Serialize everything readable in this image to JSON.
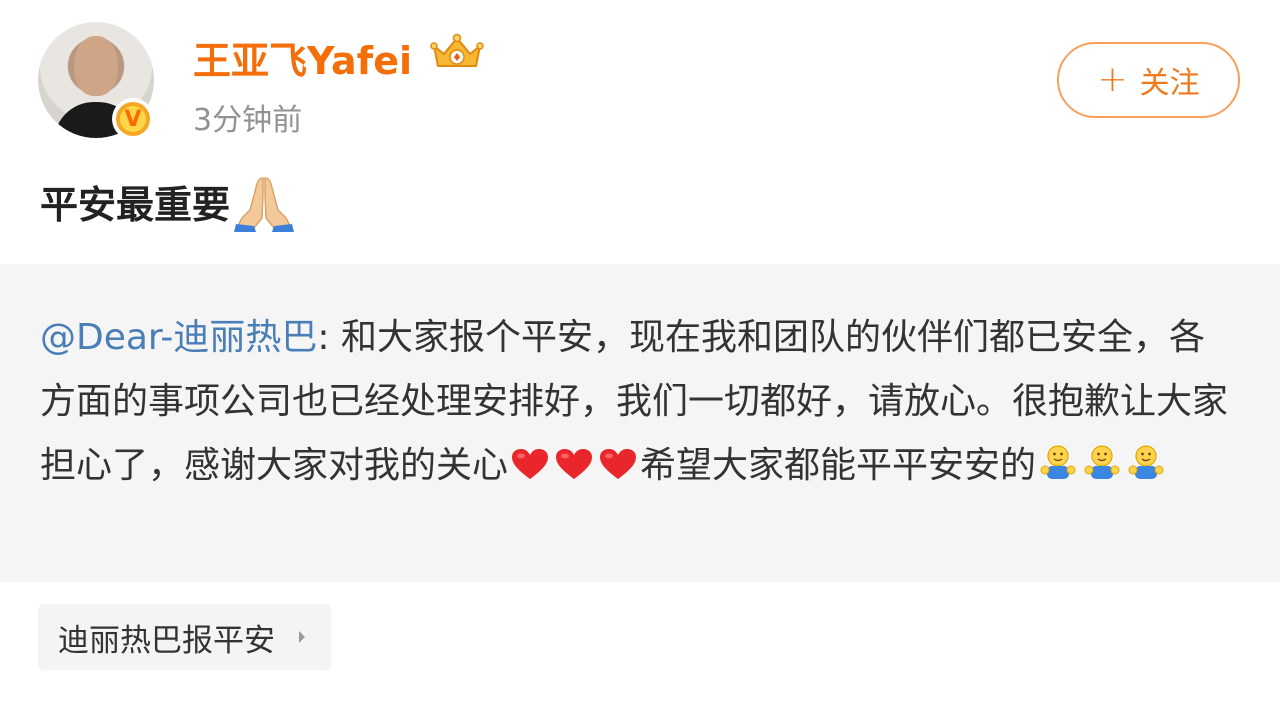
{
  "header": {
    "username": "王亚飞Yafei",
    "timestamp": "3分钟前",
    "verified_badge": "V",
    "follow_label": "关注",
    "follow_plus": "+"
  },
  "post": {
    "text": "平安最重要"
  },
  "repost": {
    "mention": "@Dear-迪丽热巴",
    "text_part1": ": 和大家报个平安，现在我和团队的伙伴们都已安全，各方面的事项公司也已经处理安排好，我们一切都好，请放心。很抱歉让大家担心了，感谢大家对我的关心",
    "text_part2": "希望大家都能平平安安的"
  },
  "topic": {
    "label": "迪丽热巴报平安"
  },
  "colors": {
    "username": "#f46f0a",
    "mention": "#4a7eb6",
    "follow_border": "#f8a15a",
    "repost_bg": "#f5f5f5"
  },
  "icons": {
    "user_badge": "crown-icon",
    "verified": "verified-icon",
    "post_emoji": "pray-icon",
    "heart": "heart-icon",
    "hug": "hug-icon",
    "topic_arrow": "chevron-right-icon"
  }
}
